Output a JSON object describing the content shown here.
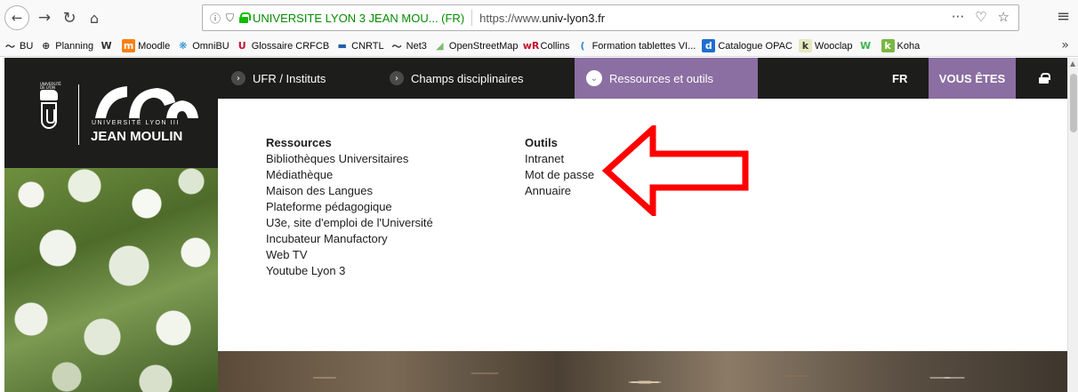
{
  "browser": {
    "nav": {
      "back": "←",
      "forward": "→",
      "reload": "↻",
      "home": "⌂"
    },
    "urlbar": {
      "info_icon": "ⓘ",
      "shield_icon": "⛉",
      "site_identity": "UNIVERSITE LYON 3 JEAN MOU... (FR)",
      "url_prefix": "https://www.",
      "url_domain": "univ-lyon3.fr",
      "actions": [
        "···",
        "♡",
        "☆"
      ]
    },
    "menu_icon": "≡"
  },
  "bookmarks": {
    "items": [
      {
        "label": "BU",
        "icon": "〜",
        "icon_color": "#333333",
        "icon_bg": "transparent"
      },
      {
        "label": "Planning",
        "icon": "⊕",
        "icon_color": "#333333",
        "icon_bg": "transparent"
      },
      {
        "label": "",
        "icon": "W",
        "icon_color": "#333333",
        "icon_bg": "transparent"
      },
      {
        "label": "Moodle",
        "icon": "m",
        "icon_color": "#ffffff",
        "icon_bg": "#f98012"
      },
      {
        "label": "OmniBU",
        "icon": "❋",
        "icon_color": "#2a8fd4",
        "icon_bg": "transparent"
      },
      {
        "label": "Glossaire CRFCB",
        "icon": "U",
        "icon_color": "#c8102e",
        "icon_bg": "transparent"
      },
      {
        "label": "CNRTL",
        "icon": "▬",
        "icon_color": "#1f5fa8",
        "icon_bg": "transparent"
      },
      {
        "label": "Net3",
        "icon": "〜",
        "icon_color": "#333333",
        "icon_bg": "transparent"
      },
      {
        "label": "OpenStreetMap",
        "icon": "◢",
        "icon_color": "#7ebc6f",
        "icon_bg": "transparent"
      },
      {
        "label": "Collins",
        "icon": "wR",
        "icon_color": "#c8102e",
        "icon_bg": "transparent"
      },
      {
        "label": "Formation tablettes VI...",
        "icon": "(",
        "icon_color": "#2a8fd4",
        "icon_bg": "transparent"
      },
      {
        "label": "Catalogue OPAC",
        "icon": "d",
        "icon_color": "#ffffff",
        "icon_bg": "#1f6fd1"
      },
      {
        "label": "Wooclap",
        "icon": "k",
        "icon_color": "#333333",
        "icon_bg": "#e8e8c0"
      },
      {
        "label": "",
        "icon": "W",
        "icon_color": "#40b450",
        "icon_bg": "transparent"
      },
      {
        "label": "Koha",
        "icon": "k",
        "icon_color": "#ffffff",
        "icon_bg": "#79b843"
      }
    ],
    "overflow": "»"
  },
  "logo": {
    "crest_text": "UNIVERSITÉ DE LYON",
    "subtitle": "UNIVERSITÉ LYON III",
    "title": "JEAN MOULIN"
  },
  "site_nav": {
    "chevron_right": "›",
    "chevron_down": "⌄",
    "ufr": "UFR / Instituts",
    "champs": "Champs disciplinaires",
    "ressources": "Ressources et outils",
    "lang": "FR",
    "vous": "VOUS ÊTES"
  },
  "dropdown": {
    "ressources": {
      "heading": "Ressources",
      "links": [
        "Bibliothèques Universitaires",
        "Médiathèque",
        "Maison des Langues",
        "Plateforme pédagogique",
        "U3e, site d'emploi de l'Université",
        "Incubateur Manufactory",
        "Web TV",
        "Youtube Lyon 3"
      ]
    },
    "outils": {
      "heading": "Outils",
      "links": [
        "Intranet",
        "Mot de passe",
        "Annuaire"
      ]
    }
  },
  "scrollbar": {
    "up": "▲"
  },
  "colors": {
    "brand_dark": "#1d1d1b",
    "accent_purple": "#8b6ea2",
    "annotation_red": "#ff0000",
    "secure_green": "#12bc00"
  }
}
